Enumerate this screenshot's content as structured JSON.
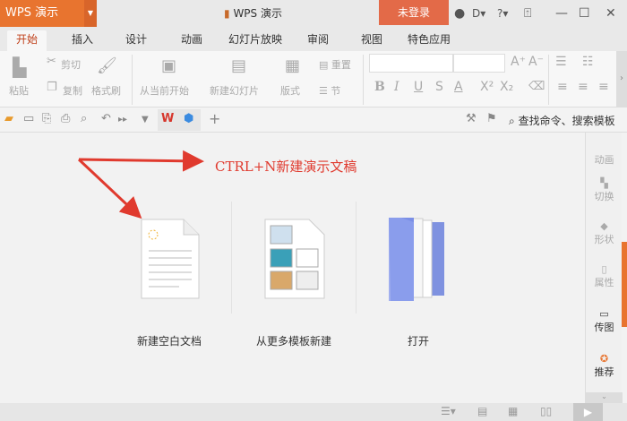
{
  "titlebar": {
    "app_menu": "WPS 演示",
    "title": "WPS 演示",
    "login": "未登录"
  },
  "tabs": [
    "开始",
    "插入",
    "设计",
    "动画",
    "幻灯片放映",
    "审阅",
    "视图",
    "特色应用"
  ],
  "ribbon": {
    "paste": "粘贴",
    "cut": "剪切",
    "copy": "复制",
    "format_painter": "格式刷",
    "from_current": "从当前开始",
    "new_slide": "新建幻灯片",
    "layout": "版式",
    "reset": "重置",
    "section": "节",
    "bold": "B",
    "italic": "I",
    "underline": "U",
    "strike": "S",
    "font_color": "A",
    "superscript": "X²",
    "subscript": "X₂"
  },
  "quick": {
    "search": "查找命令、搜索模板"
  },
  "main": {
    "hint": "CTRL+N新建演示文稿",
    "cards": [
      "新建空白文档",
      "从更多模板新建",
      "打开"
    ]
  },
  "right_panel": [
    "动画",
    "切换",
    "形状",
    "属性",
    "传图",
    "推荐"
  ]
}
